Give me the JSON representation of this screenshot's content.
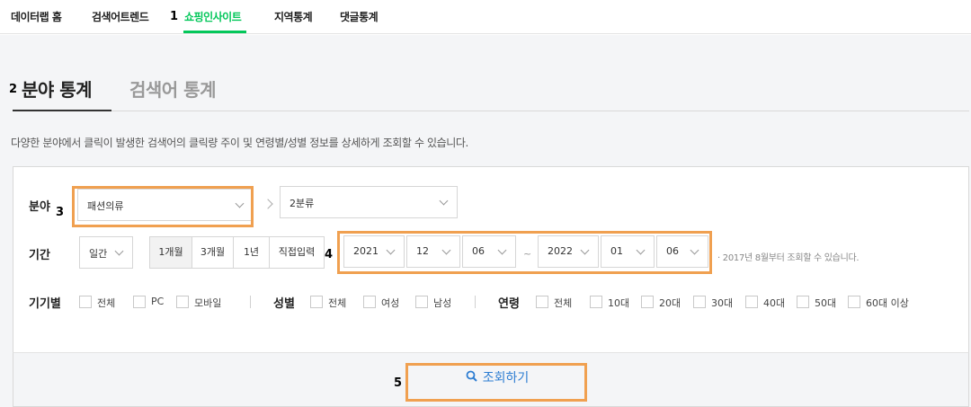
{
  "nav": {
    "items": [
      {
        "label": "데이터랩 홈"
      },
      {
        "label": "검색어트렌드"
      },
      {
        "label": "쇼핑인사이트"
      },
      {
        "label": "지역통계"
      },
      {
        "label": "댓글통계"
      }
    ],
    "active_index": 2
  },
  "markers": [
    "1",
    "2",
    "3",
    "4",
    "5"
  ],
  "tabs": [
    {
      "label": "분야 통계"
    },
    {
      "label": "검색어 통계"
    }
  ],
  "description": "다양한 분야에서 클릭이 발생한 검색어의 클릭량 주이 및 연령별/성별 정보를 상세하게 조회할 수 있습니다.",
  "filters": {
    "category_label": "분야",
    "category1_value": "패션의류",
    "category2_value": "2분류",
    "period_label": "기간",
    "period_unit": "일간",
    "period_buttons": [
      "1개월",
      "3개월",
      "1년",
      "직접입력"
    ],
    "start": {
      "year": "2021",
      "month": "12",
      "day": "06"
    },
    "date_separator": "~",
    "end": {
      "year": "2022",
      "month": "01",
      "day": "06"
    },
    "date_note": "· 2017년 8월부터 조회할 수 있습니다.",
    "device_label": "기기별",
    "device_options": [
      "전체",
      "PC",
      "모바일"
    ],
    "gender_label": "성별",
    "gender_options": [
      "전체",
      "여성",
      "남성"
    ],
    "age_label": "연령",
    "age_options": [
      "전체",
      "10대",
      "20대",
      "30대",
      "40대",
      "50대",
      "60대 이상"
    ]
  },
  "search_button": "조회하기",
  "colors": {
    "accent_green": "#03c75a",
    "highlight_orange": "#f0a050",
    "search_blue": "#2d7dd2"
  }
}
